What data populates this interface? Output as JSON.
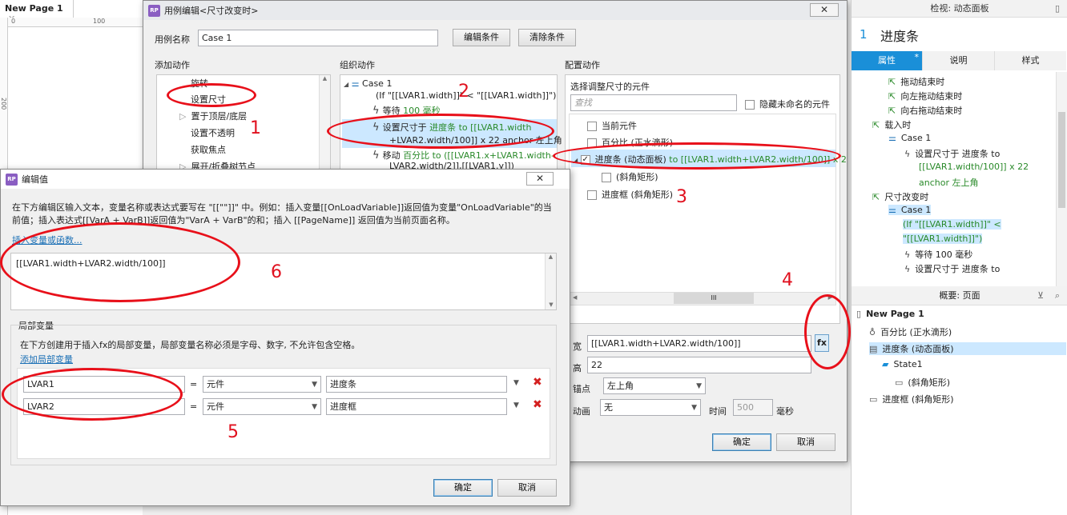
{
  "editor": {
    "tab_label": "New Page 1",
    "ruler_100": "100",
    "ruler_200": "200"
  },
  "case_dialog": {
    "title": "用例编辑<尺寸改变时>",
    "case_name_label": "用例名称",
    "case_name_value": "Case 1",
    "edit_condition_button": "编辑条件",
    "clear_condition_button": "清除条件",
    "add_action_header": "添加动作",
    "organize_action_header": "组织动作",
    "config_action_header": "配置动作",
    "add_actions": [
      "旋转",
      "设置尺寸",
      "置于顶层/底层",
      "设置不透明",
      "获取焦点",
      "展开/折叠树节点"
    ],
    "org_case_name": "Case 1",
    "org_case_condition": "(If \"[[LVAR1.width]]\" < \"[[LVAR1.width]]\")",
    "org_wait": "等待",
    "org_wait_value": "100 毫秒",
    "org_setsize_prefix": "设置尺寸于",
    "org_setsize_detail_1": "进度条 to [[LVAR1.width",
    "org_setsize_detail_2": "+LVAR2.width/100]] x 22 anchor 左上角",
    "org_move_prefix": "移动",
    "org_move_detail_1": "百分比 to ([[LVAR1.x+LVAR1.width-",
    "org_move_detail_2": "LVAR2.width/2]],[[LVAR1.y]])",
    "select_widget_label": "选择调整尺寸的元件",
    "search_placeholder": "查找",
    "hide_unnamed_label": "隐藏未命名的元件",
    "widget_list": [
      {
        "label": "当前元件",
        "detail": "",
        "checked": false
      },
      {
        "label": "百分比 (正水滴形)",
        "detail": "",
        "checked": false
      },
      {
        "label": "进度条 (动态面板)",
        "detail": "to [[LVAR1.width+LVAR2.width/100]] x 2",
        "checked": true
      },
      {
        "label": "(斜角矩形)",
        "detail": "",
        "checked": false
      },
      {
        "label": "进度框 (斜角矩形)",
        "detail": "",
        "checked": false
      }
    ],
    "width_label": "宽",
    "width_value": "[[LVAR1.width+LVAR2.width/100]]",
    "fx_label": "fx",
    "height_label": "高",
    "height_value": "22",
    "anchor_label": "锚点",
    "anchor_value": "左上角",
    "anim_label": "动画",
    "anim_value": "无",
    "time_label": "时间",
    "time_value": "500",
    "ms_label": "毫秒",
    "ok_button": "确定",
    "cancel_button": "取消"
  },
  "edit_dialog": {
    "title": "编辑值",
    "description": "在下方编辑区输入文本，变量名称或表达式要写在 \"[[\"\"]]\" 中。例如：插入变量[[OnLoadVariable]]返回值为变量\"OnLoadVariable\"的当前值；插入表达式[[VarA + VarB]]返回值为\"VarA + VarB\"的和；插入 [[PageName]] 返回值为当前页面名称。",
    "insert_link": "插入变量或函数...",
    "expression": "[[LVAR1.width+LVAR2.width/100]]",
    "local_vars_header": "局部变量",
    "local_vars_desc": "在下方创建用于插入fx的局部变量，局部变量名称必须是字母、数字, 不允许包含空格。",
    "add_local_var_link": "添加局部变量",
    "variables": [
      {
        "name": "LVAR1",
        "eq": "=",
        "type": "元件",
        "target": "进度条"
      },
      {
        "name": "LVAR2",
        "eq": "=",
        "type": "元件",
        "target": "进度框"
      }
    ],
    "ok_button": "确定",
    "cancel_button": "取消"
  },
  "inspector": {
    "title": "检视: 动态面板",
    "number": "1",
    "name": "进度条",
    "tabs": [
      "属性",
      "说明",
      "样式"
    ],
    "tab_star": "*",
    "events": [
      {
        "indent": 1,
        "kind": "event",
        "text": "拖动结束时"
      },
      {
        "indent": 1,
        "kind": "event",
        "text": "向左拖动结束时"
      },
      {
        "indent": 1,
        "kind": "event",
        "text": "向右拖动结束时"
      },
      {
        "indent": 0,
        "kind": "event",
        "text": "载入时"
      },
      {
        "indent": 1,
        "kind": "case",
        "text": "Case 1"
      },
      {
        "indent": 2,
        "kind": "action",
        "text": "设置尺寸于 进度条 to"
      },
      {
        "indent": 2,
        "kind": "text",
        "text": "[[LVAR1.width/100]] x 22"
      },
      {
        "indent": 2,
        "kind": "text",
        "text": "anchor 左上角"
      },
      {
        "indent": 0,
        "kind": "event",
        "text": "尺寸改变时"
      },
      {
        "indent": 1,
        "kind": "case",
        "text": "Case 1"
      },
      {
        "indent": 1,
        "kind": "text",
        "text": "(If \"[[LVAR1.width]]\" <"
      },
      {
        "indent": 1,
        "kind": "text",
        "text": "\"[[LVAR1.width]]\")"
      },
      {
        "indent": 2,
        "kind": "action",
        "text": "等待 100 毫秒"
      },
      {
        "indent": 2,
        "kind": "action",
        "text": "设置尺寸于 进度条 to"
      }
    ]
  },
  "outline": {
    "title": "概要: 页面",
    "items": [
      {
        "indent": 0,
        "text": "New Page 1"
      },
      {
        "indent": 1,
        "text": "百分比 (正水滴形)"
      },
      {
        "indent": 1,
        "text": "进度条 (动态面板)"
      },
      {
        "indent": 2,
        "text": "State1"
      },
      {
        "indent": 3,
        "text": "(斜角矩形)"
      },
      {
        "indent": 1,
        "text": "进度框 (斜角矩形)"
      }
    ]
  },
  "annotations": [
    "1",
    "2",
    "3",
    "4",
    "5",
    "6"
  ],
  "colors": {
    "accent": "#1a8fd8",
    "annotation": "#e8101a",
    "green_text": "#2a8a2a",
    "selection": "#cce8ff"
  }
}
